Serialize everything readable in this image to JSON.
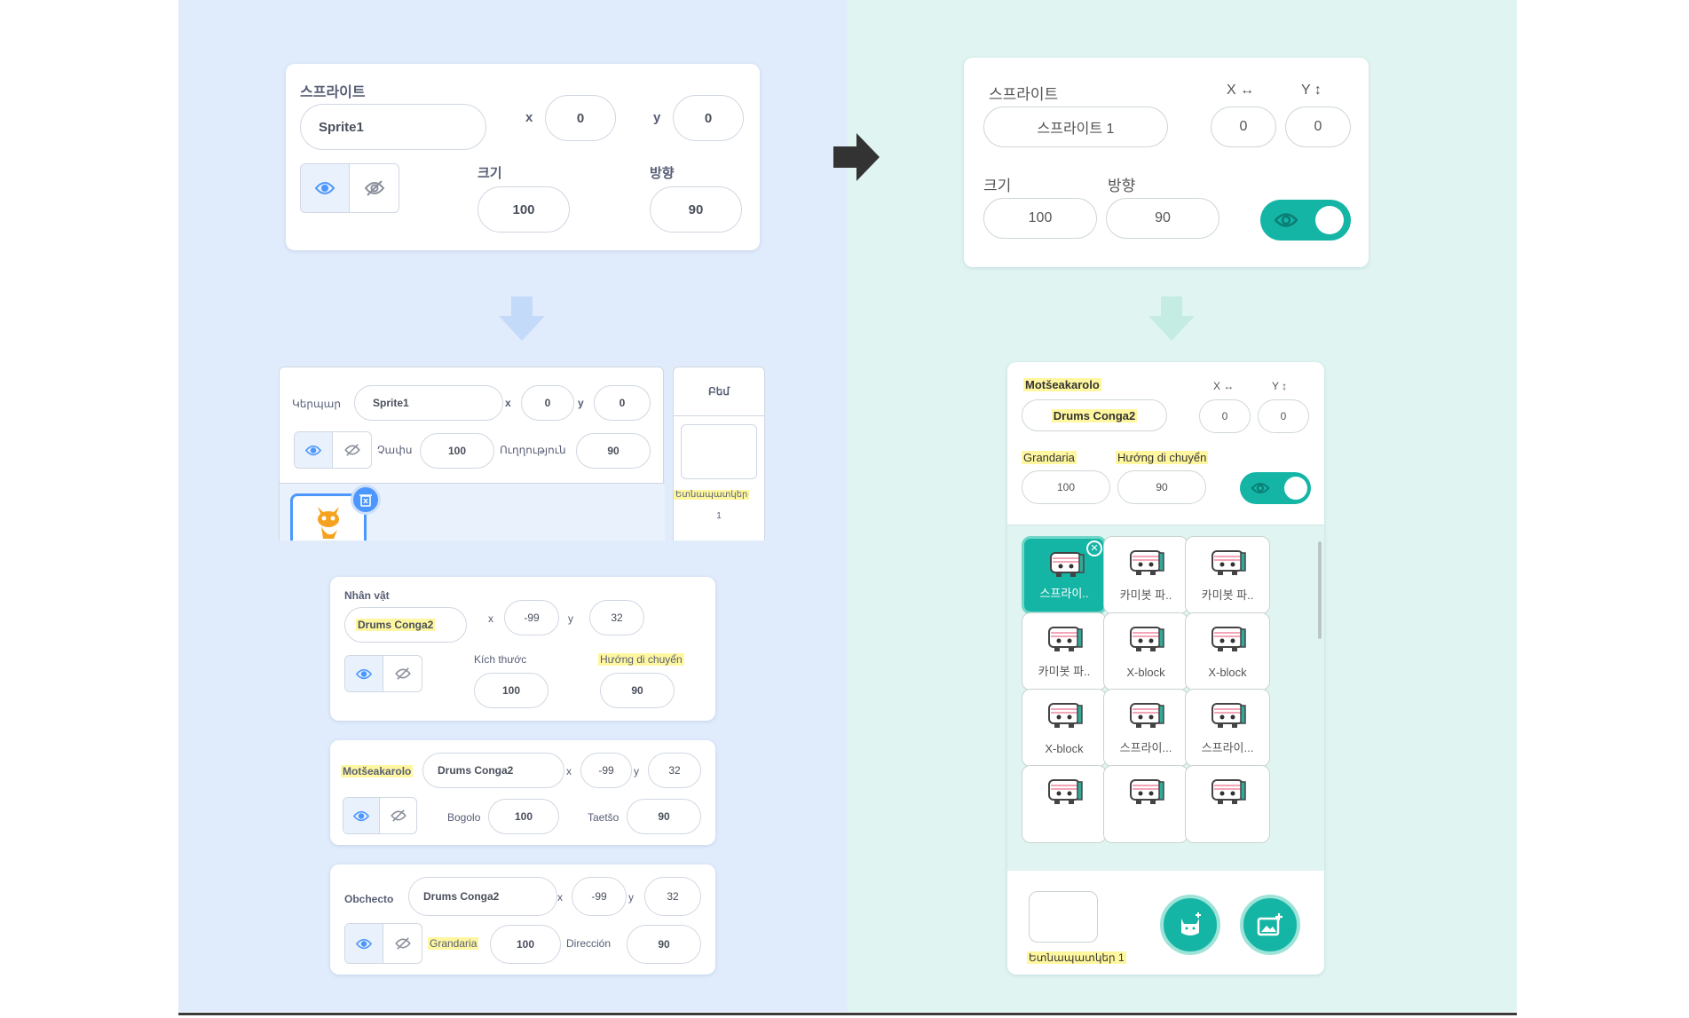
{
  "left_top": {
    "title": "스프라이트",
    "name": "Sprite1",
    "x_label": "x",
    "x": "0",
    "y_label": "y",
    "y": "0",
    "size_label": "크기",
    "size": "100",
    "dir_label": "방향",
    "dir": "90"
  },
  "left_mid": {
    "title": "Կերպար",
    "name": "Sprite1",
    "x_label": "x",
    "x": "0",
    "y_label": "y",
    "y": "0",
    "size_label": "Չափս",
    "size": "100",
    "dir_label": "Ուղղություն",
    "dir": "90",
    "stage_label": "Բեմ",
    "backdrops_label": "Ետնապատկեր",
    "backdrops": "1"
  },
  "left_vn": {
    "title": "Nhân vật",
    "name": "Drums Conga2",
    "x_label": "x",
    "x": "-99",
    "y_label": "y",
    "y": "32",
    "size_label": "Kích thước",
    "size": "100",
    "dir_label": "Hướng di chuyển",
    "dir": "90"
  },
  "left_st": {
    "title": "Motšeakarolo",
    "name": "Drums Conga2",
    "x_label": "x",
    "x": "-99",
    "y_label": "y",
    "y": "32",
    "size_label": "Bogolo",
    "size": "100",
    "dir_label": "Taetšo",
    "dir": "90"
  },
  "left_es": {
    "title": "Obchecto",
    "name": "Drums Conga2",
    "x_label": "x",
    "x": "-99",
    "y_label": "y",
    "y": "32",
    "size_label": "Grandaria",
    "size": "100",
    "dir_label": "Dirección",
    "dir": "90"
  },
  "right_top": {
    "title": "스프라이트",
    "name": "스프라이트 1",
    "x_label": "X ↔",
    "x": "0",
    "y_label": "Y ↕",
    "y": "0",
    "size_label": "크기",
    "size": "100",
    "dir_label": "방향",
    "dir": "90"
  },
  "right_bottom": {
    "title": "Motšeakarolo",
    "name": "Drums Conga2",
    "x_label": "X ↔",
    "x": "0",
    "y_label": "Y ↕",
    "y": "0",
    "size_label": "Grandaria",
    "size": "100",
    "dir_label": "Hướng di chuyển",
    "dir": "90",
    "backdrops_label": "Ետնապատկեր",
    "backdrops": "1",
    "tiles": [
      "스프라이..",
      "카미봇 파..",
      "카미봇 파..",
      "카미봇 파..",
      "X-block",
      "X-block",
      "X-block",
      "스프라이...",
      "스프라이...",
      "",
      "",
      ""
    ]
  },
  "colors": {
    "accent_blue": "#4c97ff",
    "teal": "#15b5a6",
    "highlight": "#fff7a0",
    "arrow": "#333333"
  }
}
